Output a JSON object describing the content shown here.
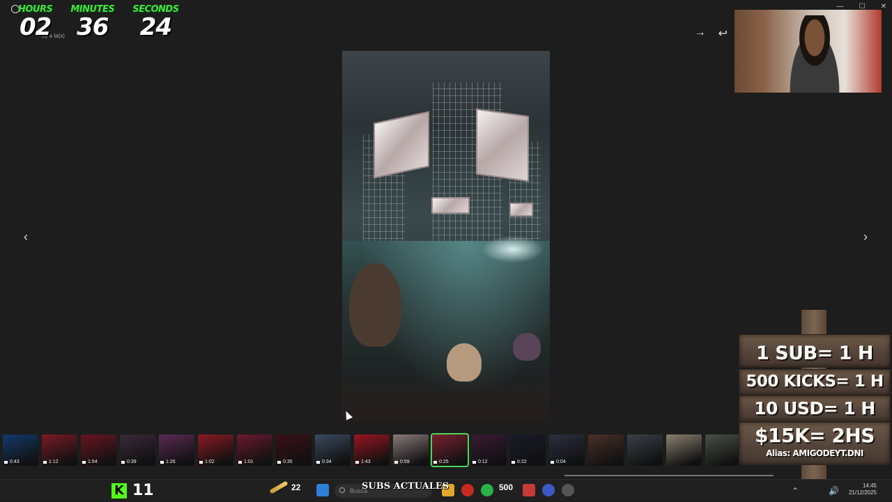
{
  "window": {
    "chat_label": "oy a la(s)",
    "controls": [
      "—",
      "☐",
      "✕"
    ]
  },
  "timer": {
    "hours_label": "HOURS",
    "minutes_label": "MINUTES",
    "seconds_label": "SECONDS",
    "hours": "02",
    "minutes": "36",
    "seconds": "24",
    "accent": "#3ee63e"
  },
  "toolbar": {
    "forward_icon": "→",
    "reply_icon": "↩"
  },
  "viewer": {
    "prev_icon": "‹",
    "next_icon": "›"
  },
  "goal_sign": {
    "line1": "1 SUB= 1 H",
    "line2": "500 KICKS= 1 H",
    "line3": "10 USD= 1 H",
    "line4": "$15K= 2HS",
    "alias": "Alias: AMIGODEYT.DNI"
  },
  "thumbnails": [
    {
      "dur": "0:43",
      "bg": "#123a6a"
    },
    {
      "dur": "1:12",
      "bg": "#7a1a25"
    },
    {
      "dur": "1:54",
      "bg": "#6a1522"
    },
    {
      "dur": "0:39",
      "bg": "#3a2a3a"
    },
    {
      "dur": "1:26",
      "bg": "#5a2a55"
    },
    {
      "dur": "1:02",
      "bg": "#8a1a22"
    },
    {
      "dur": "1:01",
      "bg": "#6a1830"
    },
    {
      "dur": "0:35",
      "bg": "#3a0f18"
    },
    {
      "dur": "0:34",
      "bg": "#3a4a60"
    },
    {
      "dur": "1:43",
      "bg": "#9a1520"
    },
    {
      "dur": "0:59",
      "bg": "#8a7a7a"
    },
    {
      "dur": "0:25",
      "bg": "#7a2030"
    },
    {
      "dur": "0:12",
      "bg": "#3a1a35"
    },
    {
      "dur": "0:22",
      "bg": "#1a1a2a"
    },
    {
      "dur": "0:04",
      "bg": "#2a3040"
    },
    {
      "dur": "",
      "bg": "#4a3028"
    },
    {
      "dur": "",
      "bg": "#3a4048"
    },
    {
      "dur": "",
      "bg": "#8a8070"
    },
    {
      "dur": "",
      "bg": "#4a5048"
    }
  ],
  "taskbar": {
    "kick_logo": "K",
    "kick_count": "11",
    "feather_count": "22",
    "search_placeholder": "Busca",
    "subs_label": "SUBS ACTUALES",
    "kicks_count": "500",
    "time": "14:45",
    "date": "21/12/2025"
  }
}
